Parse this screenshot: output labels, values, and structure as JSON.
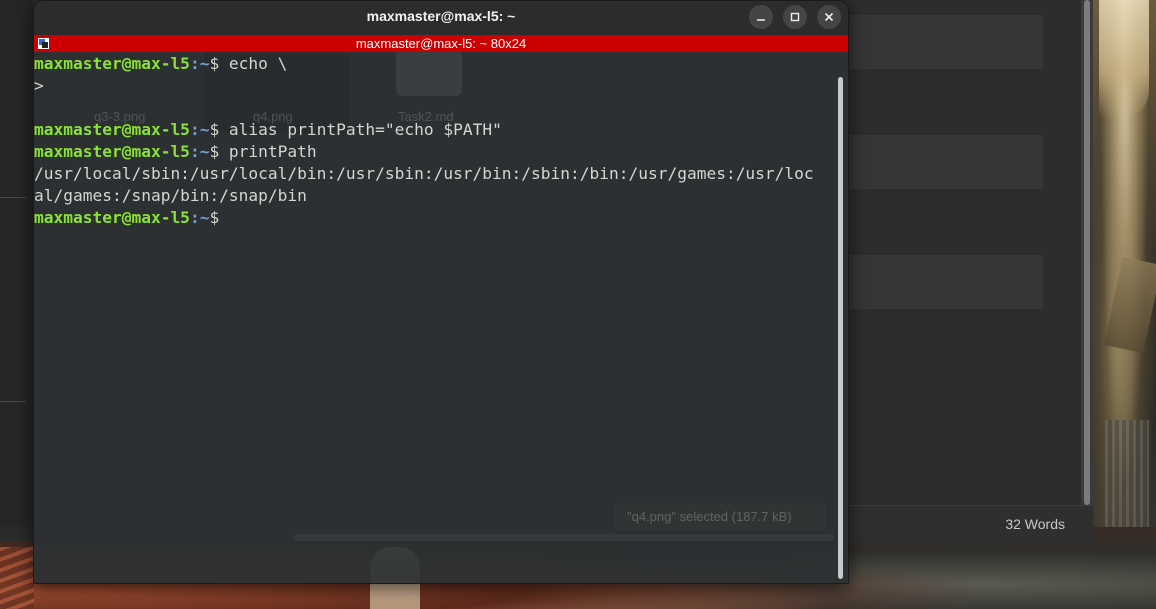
{
  "terminal": {
    "window_title": "maxmaster@max-l5: ~",
    "tab_title": "maxmaster@max-l5: ~ 80x24",
    "prompt": {
      "user_host": "maxmaster@max-l5",
      "separator": ":",
      "path": "~",
      "dollar": "$"
    },
    "lines": [
      {
        "type": "command",
        "text": " echo \\"
      },
      {
        "type": "output",
        "text": ">"
      },
      {
        "type": "output",
        "text": ""
      },
      {
        "type": "command",
        "text": " alias printPath=\"echo $PATH\""
      },
      {
        "type": "command",
        "text": " printPath"
      },
      {
        "type": "output",
        "text": "/usr/local/sbin:/usr/local/bin:/usr/sbin:/usr/bin:/sbin:/bin:/usr/games:/usr/loc"
      },
      {
        "type": "output",
        "text": "al/games:/snap/bin:/snap/bin"
      },
      {
        "type": "command",
        "text": ""
      }
    ],
    "buttons": {
      "minimize": "minimize",
      "maximize": "maximize",
      "close": "close"
    }
  },
  "background_files": {
    "file_1": "q3-3.png",
    "file_2": "q4.png",
    "file_3": "Task2.md",
    "selection_status": "\"q4.png\" selected  (187.7 kB)"
  },
  "background_editor": {
    "word_count": "32 Words"
  },
  "colors": {
    "tab_bar": "#cc0000",
    "prompt_user": "#8ae234",
    "prompt_path": "#729fcf",
    "terminal_bg": "#2c3033"
  }
}
